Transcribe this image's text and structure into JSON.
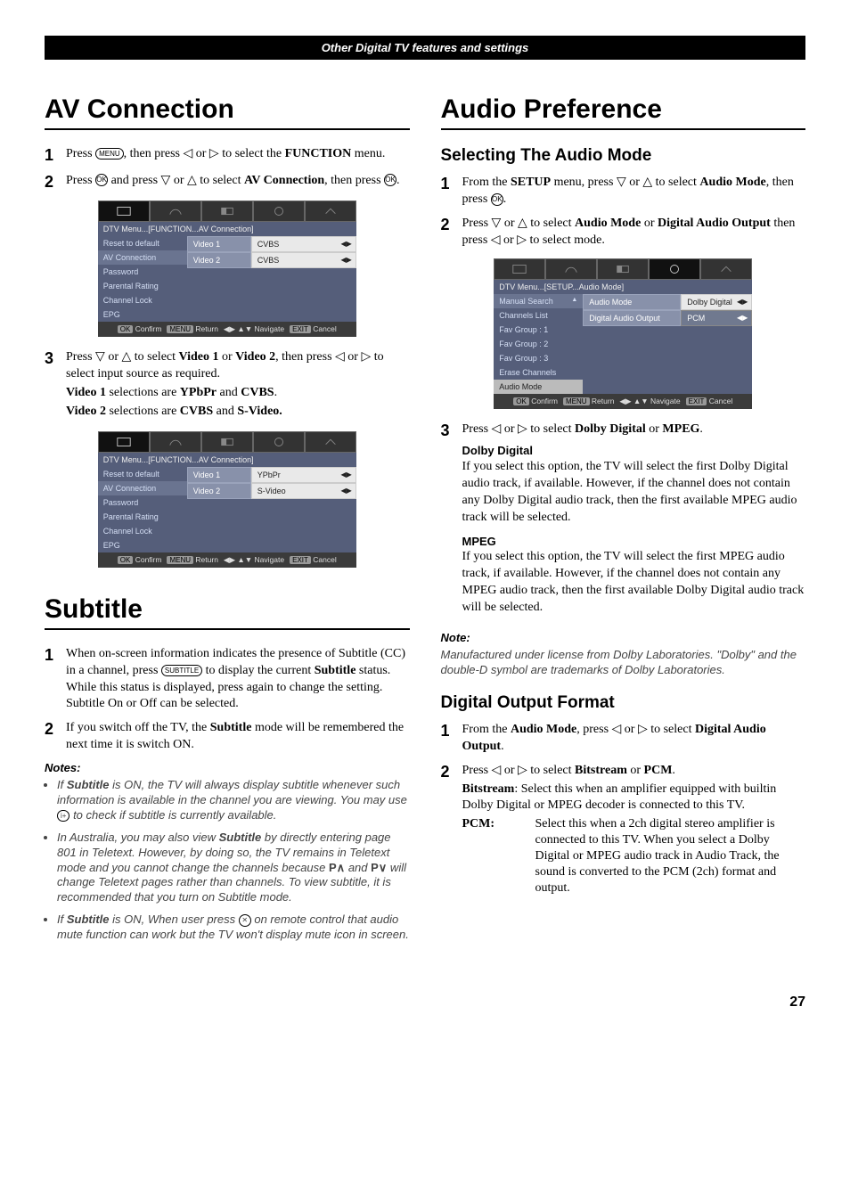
{
  "header": "Other Digital TV features and settings",
  "page_number": "27",
  "left": {
    "av": {
      "title": "AV Connection",
      "s1": "Press ",
      "s1b": ", then press ◁ or ▷ to select the ",
      "s1c": "FUNCTION",
      "s1d": " menu.",
      "s2a": "Press ",
      "s2b": " and press ▽ or △ to select ",
      "s2c": "AV Connection",
      "s2d": ", then press ",
      "s3a": "Press ▽ or △ to select ",
      "s3b": "Video 1",
      "s3c": " or ",
      "s3d": "Video 2",
      "s3e": ", then press ◁ or ▷ to select input source as required.",
      "s3f": "Video 1",
      "s3g": " selections are ",
      "s3h": "YPbPr",
      "s3i": " and ",
      "s3j": "CVBS",
      "s3k": ".",
      "s3l": "Video 2",
      "s3m": " selections are ",
      "s3n": "CVBS",
      "s3o": " and ",
      "s3p": "S-Video."
    },
    "osd1": {
      "crumb": "DTV Menu...[FUNCTION...AV Connection]",
      "left": [
        "Reset to default",
        "AV Connection",
        "Password",
        "Parental Rating",
        "Channel Lock",
        "EPG"
      ],
      "rows": [
        {
          "label": "Video 1",
          "val": "CVBS"
        },
        {
          "label": "Video 2",
          "val": "CVBS"
        }
      ],
      "hint": {
        "ok": "OK",
        "confirm": "Confirm",
        "menu": "MENU",
        "ret": "Return",
        "nav": "Navigate",
        "exit": "EXIT",
        "cancel": "Cancel"
      }
    },
    "osd2": {
      "crumb": "DTV Menu...[FUNCTION...AV Connection]",
      "left": [
        "Reset to default",
        "AV Connection",
        "Password",
        "Parental Rating",
        "Channel Lock",
        "EPG"
      ],
      "rows": [
        {
          "label": "Video 1",
          "val": "YPbPr"
        },
        {
          "label": "Video 2",
          "val": "S-Video"
        }
      ]
    },
    "subtitle": {
      "title": "Subtitle",
      "s1": "When on-screen information indicates the presence of Subtitle (CC) in a channel, press ",
      "s1b": " to display the current ",
      "s1c": "Subtitle",
      "s1d": " status. While this status is displayed, press again to change the setting. Subtitle On or Off can be selected.",
      "s2a": "If you switch off the TV, the ",
      "s2b": "Subtitle",
      "s2c": " mode will be remembered the next time it is switch ON.",
      "notes_head": "Notes:",
      "n1a": "If ",
      "n1b": "Subtitle",
      "n1c": " is ON, the TV will always display subtitle whenever such information is available in the channel you are viewing. You may use ",
      "n1d": " to check if subtitle is currently available.",
      "n2a": "In Australia, you may also view ",
      "n2b": "Subtitle",
      "n2c": " by directly entering page 801 in Teletext. However, by doing so, the TV remains in Teletext mode and you cannot change the channels because ",
      "n2d": " and ",
      "n2e": " will change Teletext pages rather than channels. To view subtitle, it is recommended that you turn on Subtitle mode.",
      "n3a": "If ",
      "n3b": "Subtitle",
      "n3c": " is ON, When user press ",
      "n3d": " on remote control that audio mute function can work but the TV won't display mute icon in screen."
    }
  },
  "right": {
    "audio": {
      "title": "Audio Preference",
      "sub1": "Selecting The Audio Mode",
      "s1a": "From the ",
      "s1b": "SETUP",
      "s1c": " menu, press ▽ or △ to select ",
      "s1d": "Audio Mode",
      "s1e": ", then press ",
      "s2a": "Press ▽ or △ to select ",
      "s2b": "Audio Mode",
      "s2c": " or ",
      "s2d": "Digital Audio Output",
      "s2e": " then press ◁ or ▷ to select mode.",
      "s3a": "Press ◁ or ▷ to select ",
      "s3b": "Dolby Digital",
      "s3c": " or ",
      "s3d": "MPEG",
      "s3e": ".",
      "dd_h": "Dolby Digital",
      "dd_p": "If you select this option, the TV will select the first Dolby Digital audio track, if available. However, if the channel does not contain any Dolby Digital audio track, then the first available MPEG audio track will be selected.",
      "mp_h": "MPEG",
      "mp_p": "If you select this option, the TV will select the first MPEG audio track, if available. However, if the channel does not contain any MPEG audio track, then the first available Dolby Digital audio track will be selected.",
      "note_h": "Note:",
      "note_p": "Manufactured under license from Dolby Laboratories. \"Dolby\" and the double-D symbol are trademarks of Dolby Laboratories.",
      "sub2": "Digital Output Format",
      "d1a": "From the ",
      "d1b": "Audio Mode",
      "d1c": ", press ◁ or ▷ to select ",
      "d1d": "Digital Audio Output",
      "d1e": ".",
      "d2a": "Press ◁ or ▷ to select ",
      "d2b": "Bitstream",
      "d2c": " or ",
      "d2d": "PCM",
      "d2e": ".",
      "bs_t": "Bitstream",
      "bs_d": ": Select this when an amplifier equipped with builtin Dolby Digital or MPEG decoder is connected to this TV.",
      "pcm_t": "PCM",
      "pcm_d": "Select this when a 2ch digital stereo amplifier is connected to this TV. When you select a Dolby Digital or MPEG audio track in Audio Track, the sound is converted to the PCM (2ch) format and output."
    },
    "osd3": {
      "crumb": "DTV Menu...[SETUP...Audio Mode]",
      "left": [
        "Manual Search",
        "Channels List",
        "Fav Group : 1",
        "Fav Group : 2",
        "Fav Group : 3",
        "Erase Channels",
        "Audio Mode"
      ],
      "rows": [
        {
          "label": "Audio Mode",
          "val": "Dolby Digital"
        },
        {
          "label": "Digital Audio Output",
          "val": "PCM"
        }
      ]
    }
  }
}
